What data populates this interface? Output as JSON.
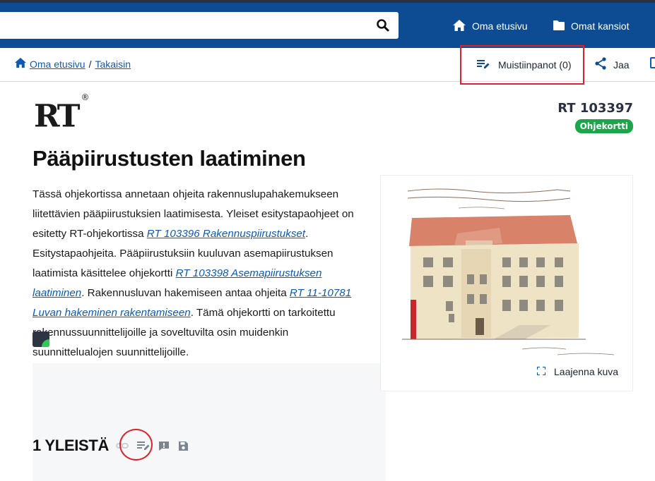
{
  "header": {
    "search": {
      "placeholder": "",
      "value": ""
    },
    "nav": [
      {
        "label": "Oma etusivu",
        "icon": "home-icon"
      },
      {
        "label": "Omat kansiot",
        "icon": "folder-icon"
      }
    ]
  },
  "breadcrumb": {
    "home": "Oma etusivu",
    "separator": "/",
    "back": "Takaisin"
  },
  "actions": {
    "notes": "Muistiinpanot (0)",
    "share": "Jaa"
  },
  "document": {
    "logo": "RT",
    "logo_mark": "®",
    "code": "RT 103397",
    "type_badge": "Ohjekortti",
    "title": "Pääpiirustusten laatiminen",
    "intro": {
      "p1": "Tässä ohjekortissa annetaan ohjeita rakennuslupahakemukseen liitettävien pääpiirustuksien laatimisesta. Yleiset esitystapaohjeet on esitetty RT-ohjekortissa ",
      "link1": "RT 103396 Rakennuspiirustukset",
      "p2": ". Esitystapaohjeita. Pääpiirustuksiin kuuluvan asemapiirustuksen laatimista käsittelee ohjekortti ",
      "link2": "RT 103398 Asemapiirustuksen laatiminen",
      "p3": ". Rakennusluvan hakemiseen antaa ohjeita ",
      "link3": "RT 11-10781 Luvan hakeminen rakentamiseen",
      "p4": ". Tämä ohjekortti on tarkoitettu rakennussuunnittelijoille ja soveltuvilta osin muidenkin suunnittelualojen suunnittelijoille."
    },
    "figure": {
      "expand_label": "Laajenna kuva"
    }
  },
  "section": {
    "title": "1 YLEISTÄ",
    "icons": [
      "link-icon",
      "note-icon",
      "feedback-icon",
      "save-icon"
    ]
  },
  "colors": {
    "header_bg": "#0d4c92",
    "link": "#0d5ab0",
    "badge": "#1ba64a",
    "highlight": "#d9242c"
  }
}
